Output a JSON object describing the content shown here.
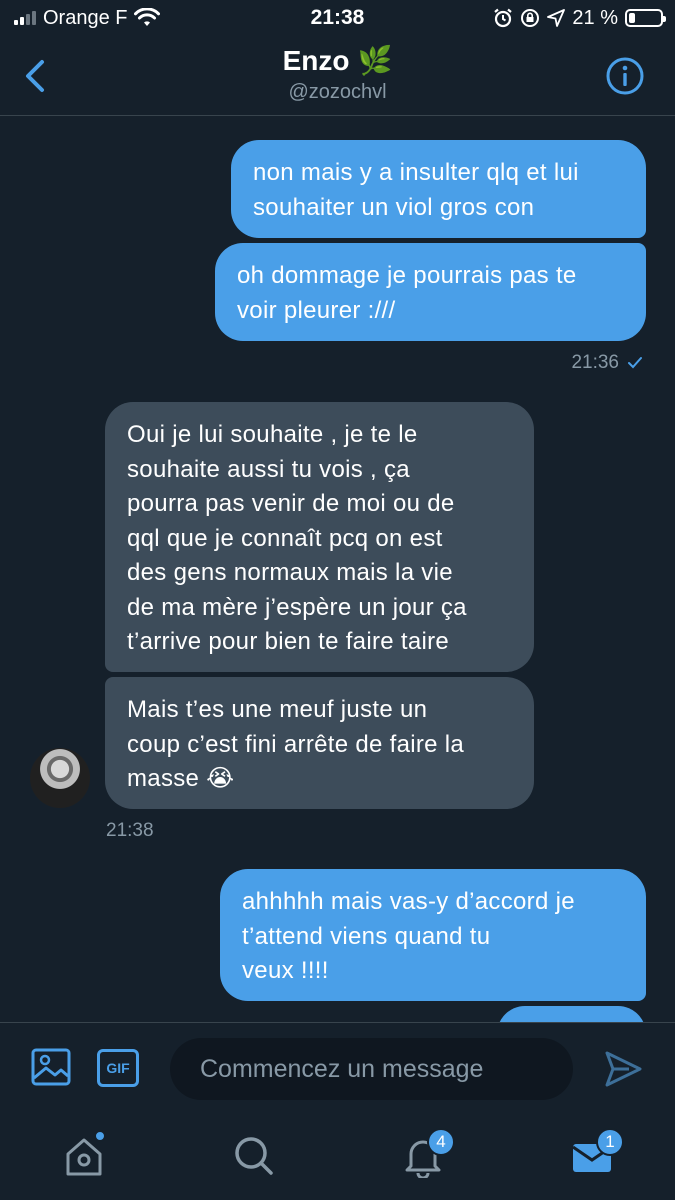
{
  "status_bar": {
    "carrier": "Orange F",
    "time": "21:38",
    "battery": "21 %",
    "battery_level": 0.21
  },
  "header": {
    "name": "Enzo",
    "emoji": "🌿",
    "handle": "@zozochvl"
  },
  "messages": [
    {
      "from": "me",
      "text": "non mais y a insulter qlq et lui\nsouhaiter un viol gros con"
    },
    {
      "from": "me",
      "text": "oh dommage je pourrais pas te\nvoir pleurer :///"
    },
    {
      "from": "them",
      "text": "Oui je lui souhaite , je te le\nsouhaite aussi tu vois ,  ça\npourra pas venir de moi ou de\nqql que je connaît pcq on est\ndes gens normaux mais la vie\nde ma mère j’espère un jour ça\nt’arrive pour bien te faire taire"
    },
    {
      "from": "them",
      "text": "Mais t’es une meuf juste un\ncoup c’est fini arrête de faire la\nmasse 😭"
    },
    {
      "from": "me",
      "text": "ahhhhh mais vas-y d’accord je\nt’attend viens quand tu\nveux !!!!"
    },
    {
      "from": "me",
      "text": ""
    }
  ],
  "timestamps": {
    "sent_time": "21:36",
    "received_time": "21:38"
  },
  "composer": {
    "placeholder": "Commencez un message",
    "gif_label": "GIF"
  },
  "tabbar": {
    "notifications_count": "4",
    "messages_count": "1"
  },
  "colors": {
    "background": "#15202b",
    "accent": "#4a9fe8",
    "received_bubble": "#3d4c5a",
    "muted_text": "#8899a6"
  }
}
